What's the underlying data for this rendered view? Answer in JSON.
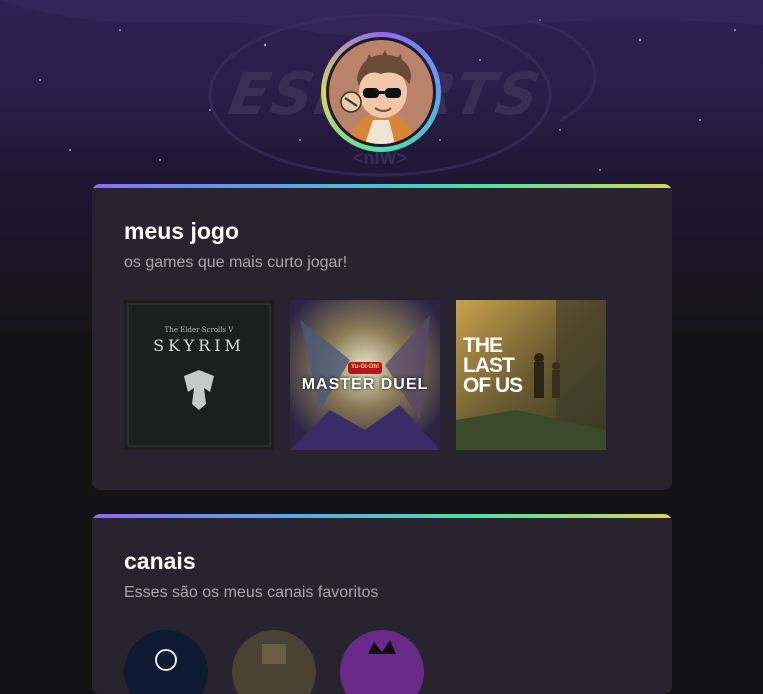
{
  "background": {
    "logo_text": "ESPORTS",
    "logo_sub": "<nIW>"
  },
  "profile": {
    "avatar": "avatar-illustration-sunglasses"
  },
  "games": {
    "title": "meus jogo",
    "subtitle": "os games que mais curto jogar!",
    "items": [
      {
        "name": "skyrim",
        "cover_top": "The Elder Scrolls V",
        "cover_title": "SKYRIM"
      },
      {
        "name": "master-duel",
        "cover_top": "Yu-Gi-Oh!",
        "cover_title": "MASTER DUEL"
      },
      {
        "name": "the-last-of-us",
        "cover_title_lines": [
          "THE",
          "LAST",
          "OF US"
        ]
      }
    ]
  },
  "channels": {
    "title": "canais",
    "subtitle": "Esses são os meus canais favoritos"
  },
  "colors": {
    "gradient": [
      "#8e6cf0",
      "#5aa4ee",
      "#4fe0a6",
      "#d8d65b"
    ],
    "card_bg": "#28242f",
    "page_bg": "#131316"
  }
}
